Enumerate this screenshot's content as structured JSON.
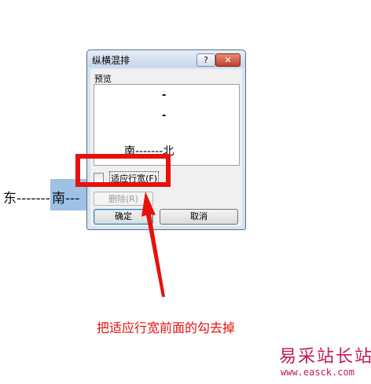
{
  "document": {
    "text_left": "东-------",
    "text_highlighted": "南---"
  },
  "dialog": {
    "title": "纵横混排",
    "help_label": "?",
    "close_label": "✕",
    "preview_label": "预览",
    "preview": {
      "dash1": "-",
      "dash2": "-",
      "line": "南-------北"
    },
    "checkbox_label": "适应行宽(F)",
    "checkbox_checked": false,
    "delete_button": "删除(R)",
    "ok_button": "确定",
    "cancel_button": "取消"
  },
  "annotation": {
    "instruction": "把适应行宽前面的勾去掉",
    "color": "#e8100c"
  },
  "watermark": {
    "site_name": "易采站长站",
    "url": "www.easck.com"
  }
}
